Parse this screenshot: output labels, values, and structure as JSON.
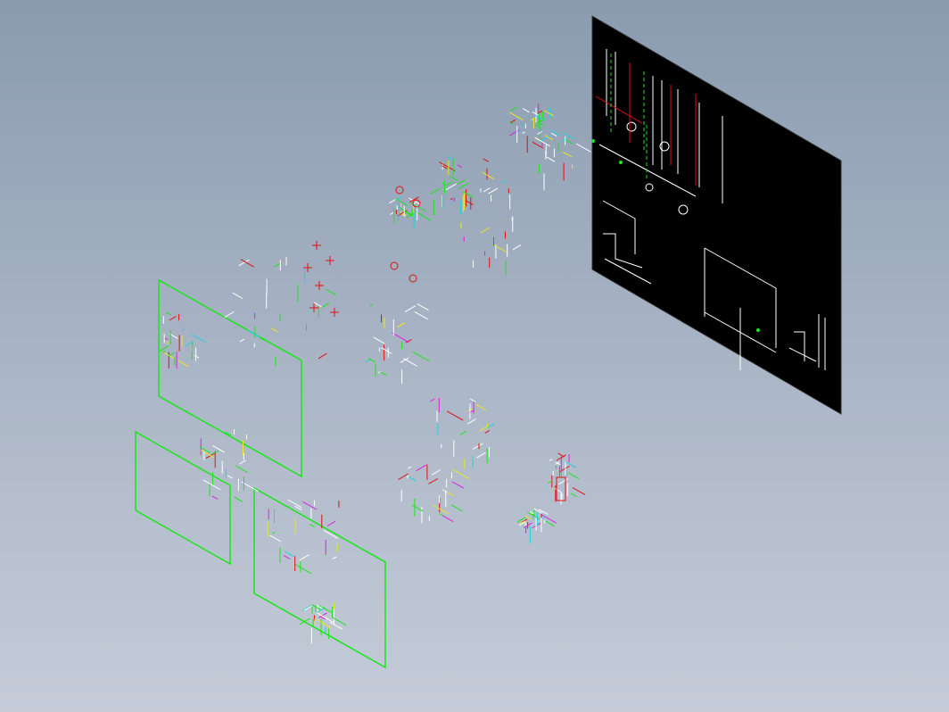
{
  "viewport": {
    "background_top": "#8a9bb0",
    "background_bottom": "#c5ccd8"
  },
  "colors": {
    "frame_green": "#19e619",
    "line_white": "#ffffff",
    "line_red": "#e01010",
    "line_magenta": "#e020e0",
    "line_cyan": "#20d0e0",
    "line_yellow": "#e8e820",
    "sheet_black": "#000000"
  },
  "layers": [
    {
      "name": "black-drawing-sheet",
      "color": "sheet_black"
    },
    {
      "name": "green-frame-large",
      "color": "frame_green"
    },
    {
      "name": "green-frame-lower-left",
      "color": "frame_green"
    },
    {
      "name": "green-frame-lower-right",
      "color": "frame_green"
    }
  ]
}
